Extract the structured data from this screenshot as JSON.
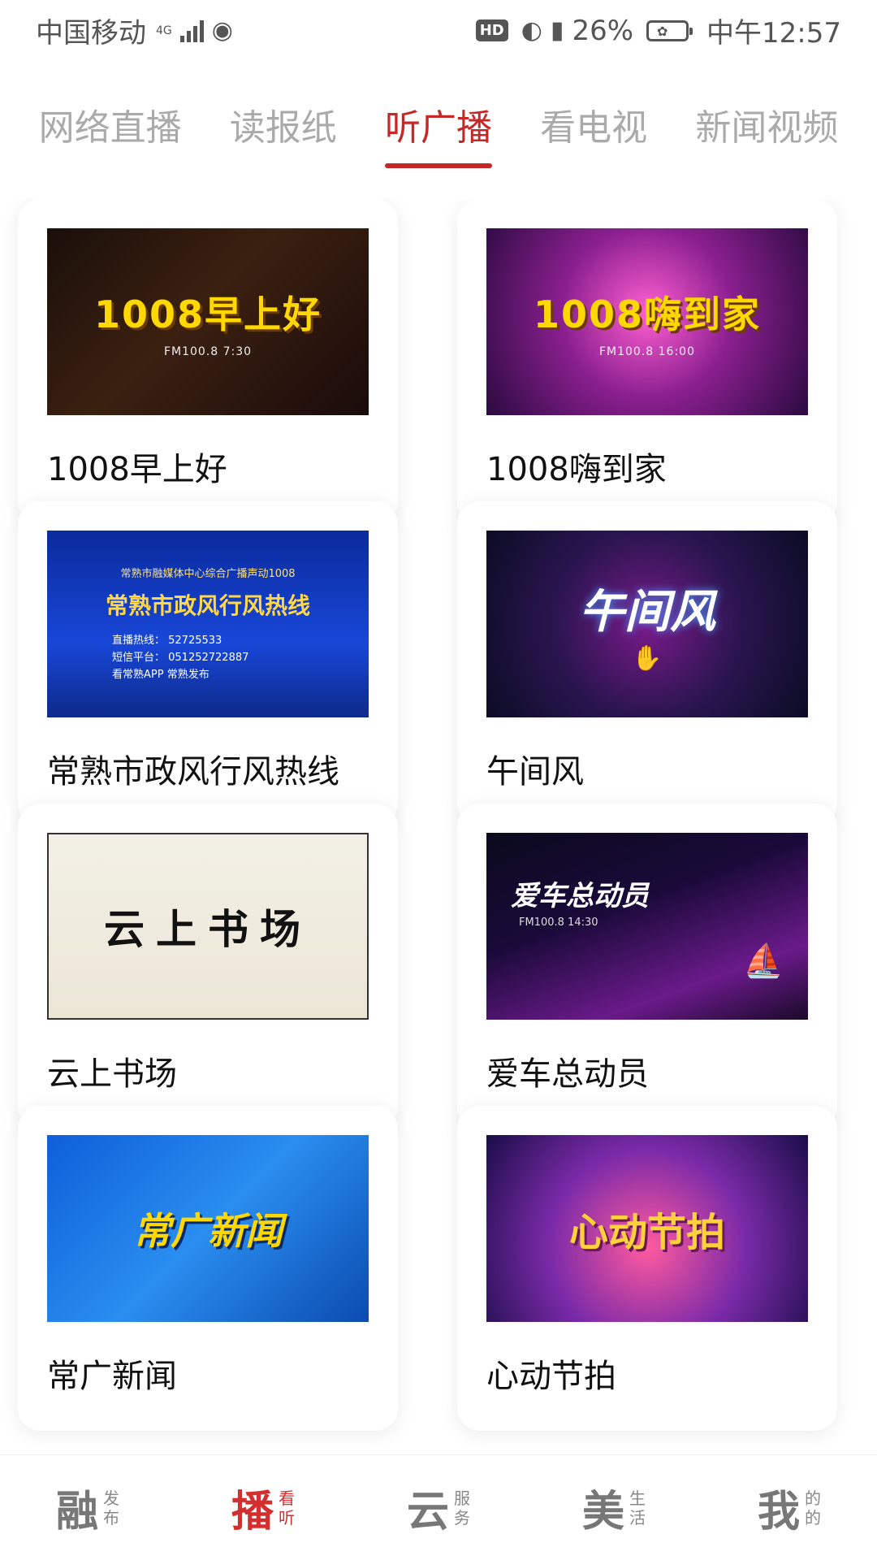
{
  "status_bar": {
    "carrier": "中国移动",
    "network": "4G",
    "battery_percent": "26%",
    "time": "中午12:57",
    "hd_label": "HD"
  },
  "tabs": [
    {
      "label": "网络直播",
      "active": false
    },
    {
      "label": "读报纸",
      "active": false
    },
    {
      "label": "听广播",
      "active": true
    },
    {
      "label": "看电视",
      "active": false
    },
    {
      "label": "新闻视频",
      "active": false
    }
  ],
  "programs": [
    {
      "title": "1008早上好",
      "thumb": {
        "logo": "1008早上好",
        "freq": "FM100.8  7:30"
      }
    },
    {
      "title": "1008嗨到家",
      "thumb": {
        "logo": "1008嗨到家",
        "freq": "FM100.8  16:00"
      }
    },
    {
      "title": "常熟市政风行风热线",
      "thumb": {
        "head": "常熟市融媒体中心综合广播声动1008",
        "logo": "常熟市政风行风热线",
        "line1": "直播热线： 52725533",
        "line2": "短信平台： 051252722887",
        "line3": "看常熟APP  常熟发布"
      }
    },
    {
      "title": "午间风",
      "thumb": {
        "logo": "午间风"
      }
    },
    {
      "title": "云上书场",
      "thumb": {
        "logo": "云上书场"
      }
    },
    {
      "title": "爱车总动员",
      "thumb": {
        "logo": "爱车总动员",
        "freq": "FM100.8 14:30"
      }
    },
    {
      "title": "常广新闻",
      "thumb": {
        "logo": "常广新闻"
      }
    },
    {
      "title": "心动节拍",
      "thumb": {
        "logo": "心动节拍"
      }
    }
  ],
  "bottom_nav": [
    {
      "big": "融",
      "top": "发",
      "bottom": "布",
      "active": false
    },
    {
      "big": "播",
      "top": "看",
      "bottom": "听",
      "active": true
    },
    {
      "big": "云",
      "top": "服",
      "bottom": "务",
      "active": false
    },
    {
      "big": "美",
      "top": "生",
      "bottom": "活",
      "active": false
    },
    {
      "big": "我",
      "top": "的",
      "bottom": "的",
      "active": false
    }
  ],
  "colors": {
    "accent": "#c62828",
    "inactive_tab": "#aaaaaa"
  }
}
